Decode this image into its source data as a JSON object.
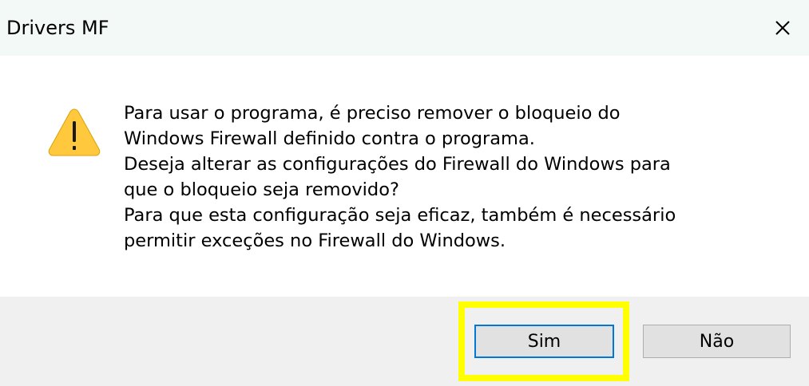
{
  "window": {
    "title": "Drivers MF",
    "close_label": "×"
  },
  "dialog": {
    "icon": "warning-icon",
    "message_lines": [
      "Para usar o programa, é preciso remover o bloqueio do",
      "Windows Firewall definido contra o programa.",
      "Deseja alterar as configurações do Firewall do Windows para",
      "que o bloqueio seja removido?",
      "Para que esta configuração seja eficaz, também é necessário",
      "permitir exceções no Firewall do Windows."
    ]
  },
  "buttons": {
    "yes_label": "Sim",
    "no_label": "Não"
  },
  "colors": {
    "titlebar": "#f3f9f6",
    "footer": "#f0f0f0",
    "highlight": "#ffff00",
    "warning_fill": "#ffc83d",
    "default_button_border": "#0078d7"
  }
}
